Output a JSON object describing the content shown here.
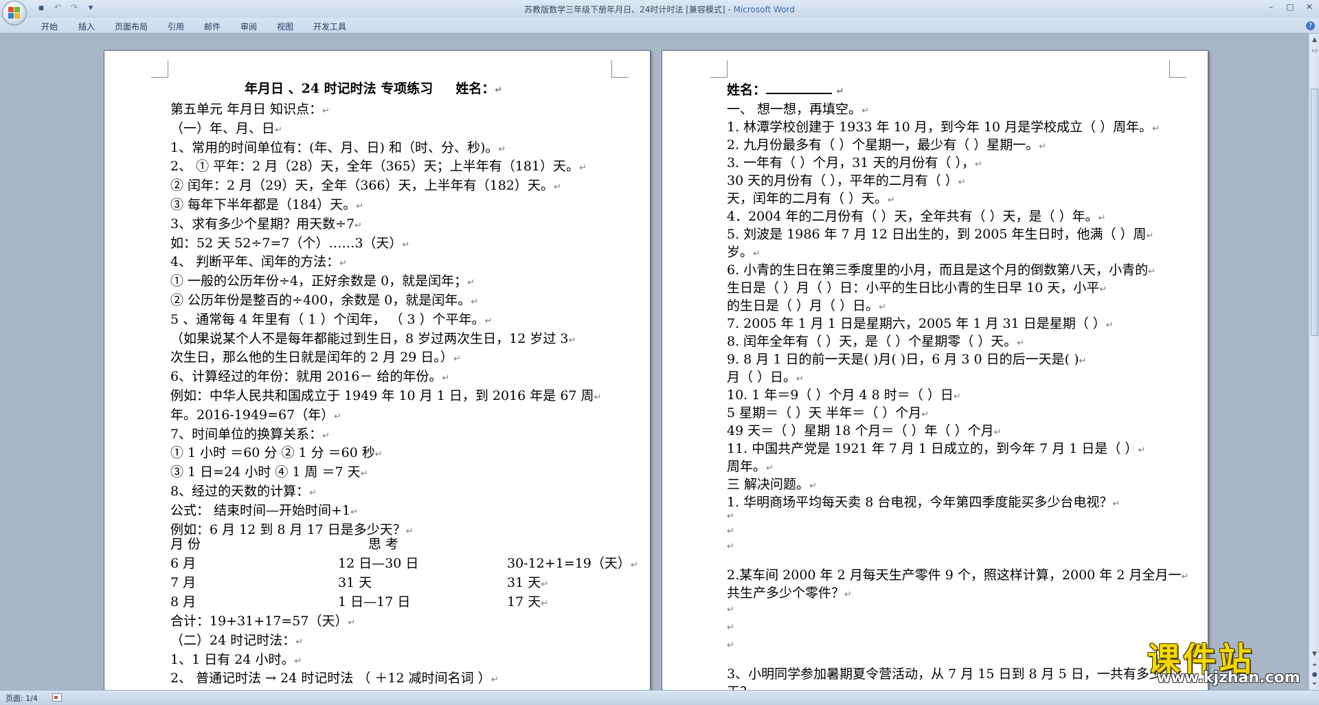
{
  "window": {
    "title": "苏教版数学三年级下册年月日、24时计时法 [兼容模式] -",
    "app_name": " Microsoft Word"
  },
  "quick_access": {
    "icons": [
      "save-icon",
      "undo-icon",
      "redo-icon",
      "customize-icon"
    ],
    "save": "▪",
    "undo": "↶",
    "redo": "↷",
    "customize": "▾"
  },
  "window_controls": {
    "minimize": "–",
    "maximize": "□",
    "close": "✕"
  },
  "ribbon": {
    "tabs": [
      "开始",
      "插入",
      "页面布局",
      "引用",
      "邮件",
      "审阅",
      "视图",
      "开发工具"
    ],
    "help": "?"
  },
  "left_page": {
    "header_line": {
      "title": "年月日 、24 时记时法     专项练习",
      "name_label": "姓名："
    },
    "lines": [
      "第五单元  年月日  知识点：",
      "（一）年、月、日",
      "1、常用的时间单位有：(年、月、日) 和（时、分、秒)。",
      "2、 ① 平年：2 月（28）天，全年（365）天；上半年有（181）天。",
      "② 闰年：2 月（29）天，全年（366）天，上半年有（182）天。",
      "③ 每年下半年都是（184）天。",
      "3、求有多少个星期？用天数÷7",
      "如：52 天      52÷7=7（个）……3（天）",
      "4、  判断平年、闰年的方法：",
      "① 一般的公历年份÷4，正好余数是 0，就是闰年；",
      "② 公历年份是整百的÷400，余数是 0，就是闰年。",
      "5 、通常每 4 年里有（  1  ）个闰年，  （  3  ）个平年。",
      "（如果说某个人不是每年都能过到生日，8 岁过两次生日，12 岁过 3",
      "次生日，那么他的生日就是闰年的 2 月 29 日。）",
      "6、计算经过的年份：就用 2016－ 给的年份。",
      "例如：中华人民共和国成立于 1949 年 10 月 1 日，到 2016 年是 67 周",
      "年。2016-1949=67（年）",
      "7、时间单位的换算关系：",
      "① 1 小时  ＝60 分        ② 1 分 ＝60 秒",
      "③ 1 日=24 小时       ④ 1 周 ＝7 天",
      "8、经过的天数的计算：",
      "公式：  结束时间—开始时间+1",
      "例如：6 月 12 到 8 月 17 日是多少天？"
    ],
    "table": {
      "headers": [
        "月    份",
        "思    考"
      ],
      "rows": [
        [
          "6    月",
          "12 日—30 日",
          "30-12+1=19（天）"
        ],
        [
          "7    月",
          "31 天",
          "31 天"
        ],
        [
          "8    月",
          "1 日—17 日",
          "17 天"
        ]
      ]
    },
    "lines_after": [
      "合计：19+31+17=57（天）",
      "（二）24 时记时法：",
      "1、1 日有 24 小时。",
      "2、  普通记时法  →  24 时记时法          （  ＋12  减时间名词  ）"
    ]
  },
  "right_page": {
    "name_label": "姓名：",
    "lines": [
      "一、    想一想，再填空。",
      "1. 林潭学校创建于 1933 年 10 月，到今年 10 月是学校成立（       ）周年。",
      "2. 九月份最多有（      ）个星期一，最少有（      ）星期一。",
      "3. 一年有（      ）个月，31 天的月份有（                                    ），",
      "   30 天的月份有（                                ），平年的二月有（        ）",
      "   天，闰年的二月有（       ）天。",
      "4．2004 年的二月份有（     ）天，全年共有（     ）天，是（    ）年。",
      "5. 刘波是 1986 年 7 月 12 日出生的，到 2005 年生日时，他满（       ）周",
      "岁。",
      "6. 小青的生日在第三季度里的小月，而且是这个月的倒数第八天，小青的",
      "   生日是（      ）月（      ）日：小平的生日比小青的生日早 10 天，小平",
      "   的生日是（      ）月（      ）日。",
      "7. 2005 年 1 月 1 日是星期六，2005 年 1 月 31 日是星期（     ）",
      "8. 闰年全年有（      ）天，是（      ）个星期零（          ）天。",
      "9. 8 月 1 日的前一天是(        )月(        )日，6 月 3 0 日的后一天是(       )",
      "    月（       ）日。",
      "10.   1 年＝9（       ）个月                 4 8 时＝（        ）日",
      "        5 星期＝（       ）天               半年＝（        ）个月",
      "      49 天＝（       ）星期      18 个月＝（       ）年（       ）个月",
      "11.   中国共产党是 1921 年 7 月 1 日成立的，到今年 7 月 1 日是（         ）",
      "      周年。",
      "三  解决问题。",
      "1. 华明商场平均每天卖 8 台电视，今年第四季度能买多少台电视？",
      "",
      "",
      "",
      "2.某车间 2000 年 2 月每天生产零件 9 个，照这样计算，2000 年 2 月全月一",
      "共生产多少个零件？",
      "",
      "",
      "",
      "3、小明同学参加暑期夏令营活动，从 7 月 15 日到 8 月 5 日，一共有多少",
      "天？"
    ]
  },
  "status_bar": {
    "page_info": "页面: 1/4"
  },
  "watermark": {
    "title": "课件站",
    "url": "www.kjzhan.com"
  },
  "colors": {
    "background": "#a9b6c6",
    "page": "#ffffff",
    "ribbon": "#cad9ec",
    "watermark_yellow": "#f5d800"
  },
  "paragraph_mark": "↵"
}
